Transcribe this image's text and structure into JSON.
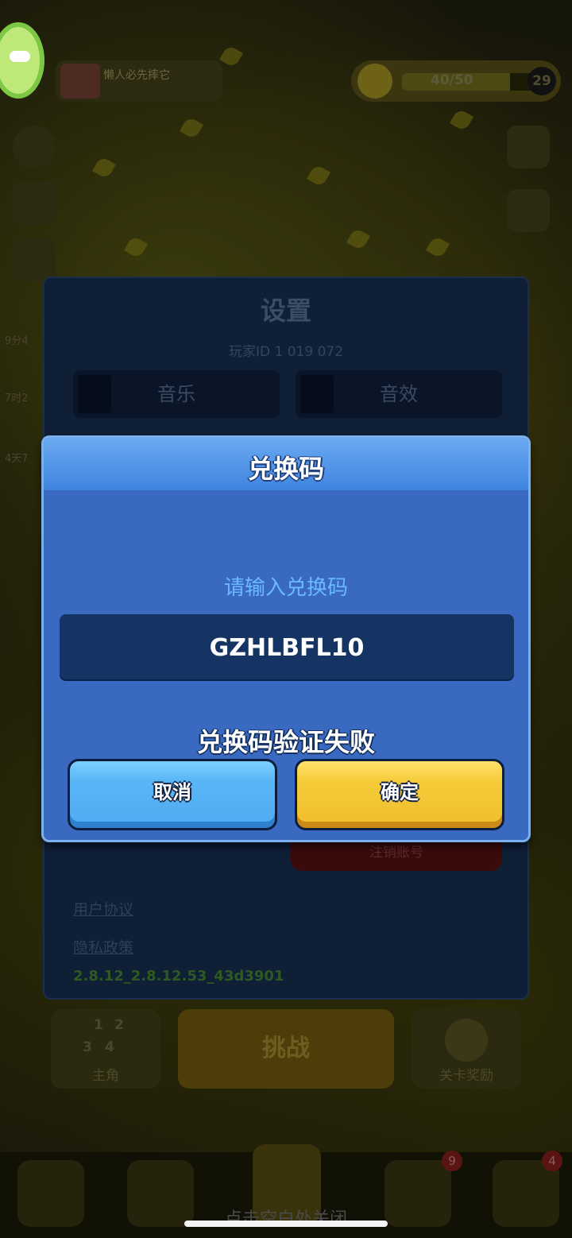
{
  "background": {
    "banner_text": "懒人必先摔它",
    "xp_text": "40/50",
    "xp_fraction": 0.8,
    "level": "29",
    "side_labels": [
      "9分4",
      "7时2",
      "4天7"
    ],
    "bottom_buttons": [
      "主角",
      "挑战",
      "关卡奖励"
    ],
    "dice_numbers": [
      "1",
      "2",
      "3",
      "4"
    ],
    "badges": [
      "9",
      "4"
    ],
    "close_hint": "点击空白处关闭"
  },
  "settings": {
    "title": "设置",
    "player_id": "玩家ID 1 019 072",
    "music_label": "音乐",
    "sfx_label": "音效",
    "logout_label": "注销账号",
    "user_agreement": "用户协议",
    "privacy_policy": "隐私政策",
    "version": "2.8.12_2.8.12.53_43d3901"
  },
  "dialog": {
    "title": "兑换码",
    "prompt": "请输入兑换码",
    "code_value": "GZHLBFL10",
    "error_message": "兑换码验证失败",
    "cancel_label": "取消",
    "confirm_label": "确定"
  },
  "colors": {
    "dialog_bg": "#3a69c2",
    "cancel_button": "#58b6f6",
    "confirm_button": "#f5cb3a",
    "prompt_text": "#69baff"
  }
}
